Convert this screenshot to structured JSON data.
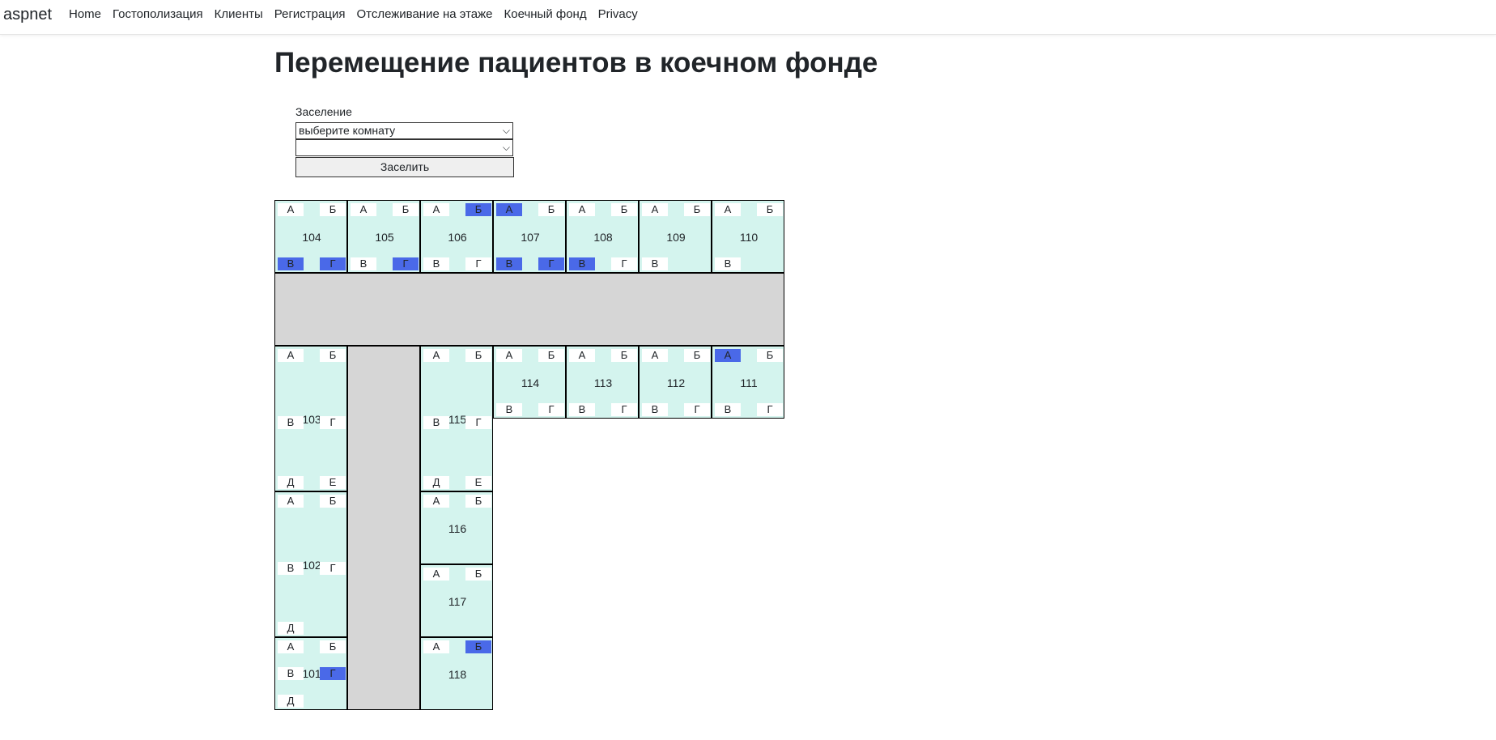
{
  "navbar": {
    "brand": "aspnet",
    "links": [
      "Home",
      "Гостополизация",
      "Клиенты",
      "Регистрация",
      "Отслеживание на этаже",
      "Коечный фонд",
      "Privacy"
    ]
  },
  "page": {
    "title": "Перемещение пациентов в коечном фонде"
  },
  "settle_form": {
    "label": "Заселение",
    "room_select_value": "выберите комнату",
    "bed_select_value": "",
    "button_label": "Заселить"
  },
  "colors": {
    "room_bg": "#d4f4ee",
    "corridor_bg": "#d6d6d6",
    "bed_free": "#ffffff",
    "bed_occupied": "#4a69e8"
  },
  "rooms": [
    {
      "number": "104",
      "beds": [
        {
          "label": "А",
          "occupied": false
        },
        {
          "label": "Б",
          "occupied": false
        },
        {
          "label": "В",
          "occupied": true
        },
        {
          "label": "Г",
          "occupied": true
        }
      ]
    },
    {
      "number": "105",
      "beds": [
        {
          "label": "А",
          "occupied": false
        },
        {
          "label": "Б",
          "occupied": false
        },
        {
          "label": "В",
          "occupied": false
        },
        {
          "label": "Г",
          "occupied": true
        }
      ]
    },
    {
      "number": "106",
      "beds": [
        {
          "label": "А",
          "occupied": false
        },
        {
          "label": "Б",
          "occupied": true
        },
        {
          "label": "В",
          "occupied": false
        },
        {
          "label": "Г",
          "occupied": false
        }
      ]
    },
    {
      "number": "107",
      "beds": [
        {
          "label": "А",
          "occupied": true
        },
        {
          "label": "Б",
          "occupied": false
        },
        {
          "label": "В",
          "occupied": true
        },
        {
          "label": "Г",
          "occupied": true
        }
      ]
    },
    {
      "number": "108",
      "beds": [
        {
          "label": "А",
          "occupied": false
        },
        {
          "label": "Б",
          "occupied": false
        },
        {
          "label": "В",
          "occupied": true
        },
        {
          "label": "Г",
          "occupied": false
        }
      ]
    },
    {
      "number": "109",
      "beds": [
        {
          "label": "А",
          "occupied": false
        },
        {
          "label": "Б",
          "occupied": false
        },
        {
          "label": "В",
          "occupied": false
        }
      ]
    },
    {
      "number": "110",
      "beds": [
        {
          "label": "А",
          "occupied": false
        },
        {
          "label": "Б",
          "occupied": false
        },
        {
          "label": "В",
          "occupied": false
        }
      ]
    },
    {
      "number": "114",
      "beds": [
        {
          "label": "А",
          "occupied": false
        },
        {
          "label": "Б",
          "occupied": false
        },
        {
          "label": "В",
          "occupied": false
        },
        {
          "label": "Г",
          "occupied": false
        }
      ]
    },
    {
      "number": "113",
      "beds": [
        {
          "label": "А",
          "occupied": false
        },
        {
          "label": "Б",
          "occupied": false
        },
        {
          "label": "В",
          "occupied": false
        },
        {
          "label": "Г",
          "occupied": false
        }
      ]
    },
    {
      "number": "112",
      "beds": [
        {
          "label": "А",
          "occupied": false
        },
        {
          "label": "Б",
          "occupied": false
        },
        {
          "label": "В",
          "occupied": false
        },
        {
          "label": "Г",
          "occupied": false
        }
      ]
    },
    {
      "number": "111",
      "beds": [
        {
          "label": "А",
          "occupied": true
        },
        {
          "label": "Б",
          "occupied": false
        },
        {
          "label": "В",
          "occupied": false
        },
        {
          "label": "Г",
          "occupied": false
        }
      ]
    },
    {
      "number": "103",
      "beds": [
        {
          "label": "А",
          "occupied": false
        },
        {
          "label": "Б",
          "occupied": false
        },
        {
          "label": "В",
          "occupied": false
        },
        {
          "label": "Г",
          "occupied": false
        },
        {
          "label": "Д",
          "occupied": false
        },
        {
          "label": "Е",
          "occupied": false
        }
      ]
    },
    {
      "number": "115",
      "beds": [
        {
          "label": "А",
          "occupied": false
        },
        {
          "label": "Б",
          "occupied": false
        },
        {
          "label": "В",
          "occupied": false
        },
        {
          "label": "Г",
          "occupied": false
        },
        {
          "label": "Д",
          "occupied": false
        },
        {
          "label": "Е",
          "occupied": false
        }
      ]
    },
    {
      "number": "102",
      "beds": [
        {
          "label": "А",
          "occupied": false
        },
        {
          "label": "Б",
          "occupied": false
        },
        {
          "label": "В",
          "occupied": false
        },
        {
          "label": "Г",
          "occupied": false
        },
        {
          "label": "Д",
          "occupied": false
        }
      ]
    },
    {
      "number": "116",
      "beds": [
        {
          "label": "А",
          "occupied": false
        },
        {
          "label": "Б",
          "occupied": false
        }
      ]
    },
    {
      "number": "117",
      "beds": [
        {
          "label": "А",
          "occupied": false
        },
        {
          "label": "Б",
          "occupied": false
        }
      ]
    },
    {
      "number": "101",
      "beds": [
        {
          "label": "А",
          "occupied": false
        },
        {
          "label": "Б",
          "occupied": false
        },
        {
          "label": "В",
          "occupied": false
        },
        {
          "label": "Г",
          "occupied": true
        },
        {
          "label": "Д",
          "occupied": false
        }
      ]
    },
    {
      "number": "118",
      "beds": [
        {
          "label": "А",
          "occupied": false
        },
        {
          "label": "Б",
          "occupied": true
        }
      ]
    }
  ]
}
